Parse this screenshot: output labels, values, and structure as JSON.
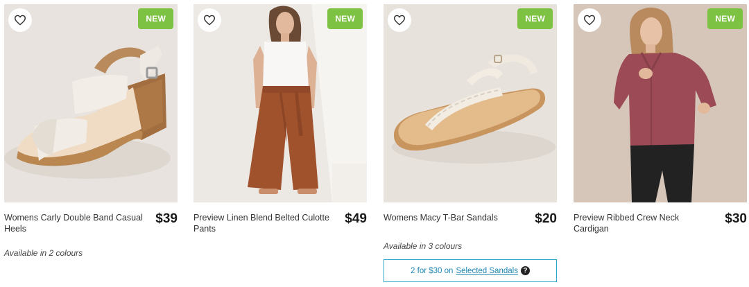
{
  "products": [
    {
      "title": "Womens Carly Double Band Casual Heels",
      "price": "$39",
      "badge": "NEW",
      "availability": "Available in 2 colours",
      "image_bg": "#e9e4df"
    },
    {
      "title": "Preview Linen Blend Belted Culotte Pants",
      "price": "$49",
      "badge": "NEW",
      "image_bg": "#ece8e4"
    },
    {
      "title": "Womens Macy T-Bar Sandals",
      "price": "$20",
      "badge": "NEW",
      "availability": "Available in 3 colours",
      "promo": {
        "text": "2 for $30 on",
        "link": "Selected Sandals",
        "help": "?"
      },
      "image_bg": "#e7e2dc"
    },
    {
      "title": "Preview Ribbed Crew Neck Cardigan",
      "price": "$30",
      "badge": "NEW",
      "image_bg": "#d8c9bd"
    }
  ],
  "colors": {
    "badge": "#7dc242",
    "promo_border": "#2aa6c9",
    "promo_text": "#1e86b3"
  },
  "icons": {
    "wishlist": "heart-outline-icon",
    "help": "question-circle-icon"
  }
}
